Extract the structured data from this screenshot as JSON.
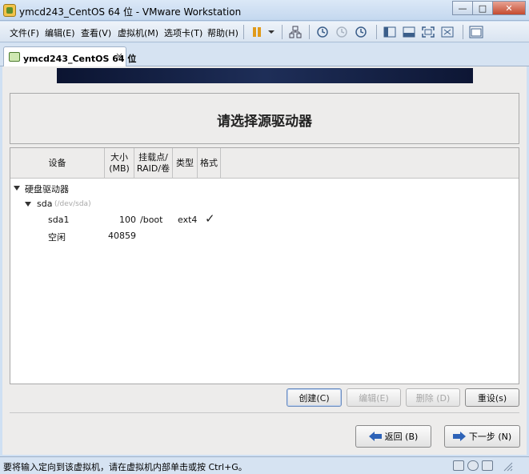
{
  "window": {
    "title": "ymcd243_CentOS 64 位 - VMware Workstation",
    "minimize": "—",
    "restore": "□",
    "close": "✕"
  },
  "menu": [
    {
      "label": "文件(F)"
    },
    {
      "label": "编辑(E)"
    },
    {
      "label": "查看(V)"
    },
    {
      "label": "虚拟机(M)"
    },
    {
      "label": "选项卡(T)"
    },
    {
      "label": "帮助(H)"
    }
  ],
  "tab": {
    "label": "ymcd243_CentOS 64 位",
    "close": "×"
  },
  "installer": {
    "title": "请选择源驱动器",
    "columns": {
      "device": "设备",
      "size": "大小\n(MB)",
      "mount": "挂载点/\nRAID/卷",
      "type": "类型",
      "format": "格式"
    },
    "tree": {
      "group_label": "硬盘驱动器",
      "disk_name": "sda",
      "disk_path": "(/dev/sda)",
      "partition": {
        "name": "sda1",
        "size": "100",
        "mount": "/boot",
        "type": "ext4",
        "format_mark": "✓"
      },
      "free": {
        "name": "空闲",
        "size": "40859"
      }
    },
    "buttons": {
      "create": "创建(C)",
      "edit": "编辑(E)",
      "delete": "删除 (D)",
      "reset": "重设(s)"
    },
    "nav": {
      "back": "返回 (B)",
      "next": "下一步 (N)"
    }
  },
  "statusbar": {
    "text": "要将输入定向到该虚拟机，请在虚拟机内部单击或按 Ctrl+G。"
  },
  "colors": {
    "accent": "#2d62b7",
    "banner": "#0b1431"
  }
}
